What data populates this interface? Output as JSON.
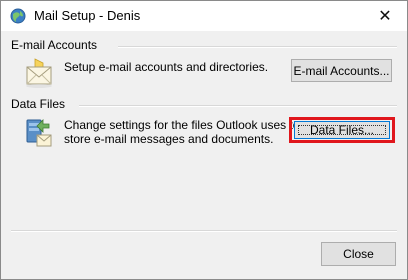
{
  "window": {
    "title": "Mail Setup - Denis",
    "app_icon": "outlook-globe-icon",
    "close_glyph": "✕"
  },
  "email_accounts": {
    "group_label": "E-mail Accounts",
    "description": "Setup e-mail accounts and directories.",
    "button_label": "E-mail Accounts...",
    "icon": "mail-envelope-icon"
  },
  "data_files": {
    "group_label": "Data Files",
    "description_line1": "Change settings for the files Outlook uses to",
    "description_line2": "store e-mail messages and documents.",
    "button_label": "Data Files...",
    "icon": "data-files-icon",
    "highlight_color": "#e0161c"
  },
  "footer": {
    "close_label": "Close"
  }
}
